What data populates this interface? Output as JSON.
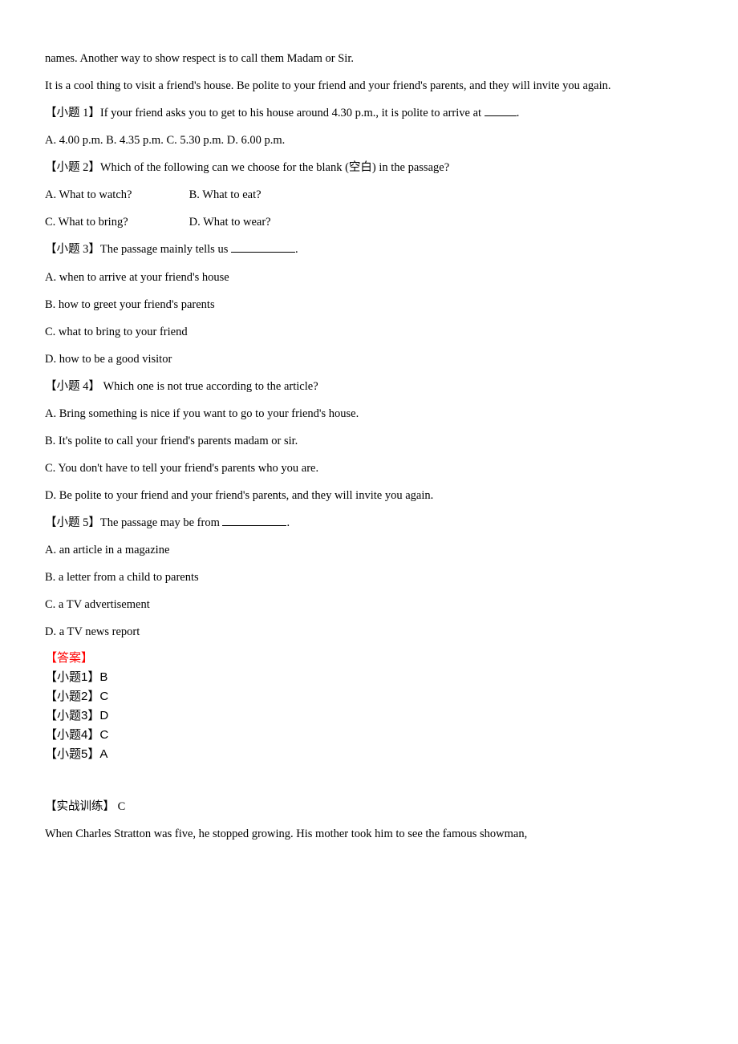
{
  "passage": {
    "line1": "names. Another way to show respect is to call them Madam or Sir.",
    "line2": "It is a cool thing to visit a friend's house. Be polite to your friend and your friend's parents, and they will invite you again."
  },
  "q1": {
    "prompt_prefix": "【小题 1】If your friend asks you to get to his house around 4.30 p.m., it is polite to arrive at ",
    "prompt_suffix": ".",
    "options": "A. 4.00 p.m. B. 4.35 p.m.    C. 5.30 p.m.    D. 6.00 p.m."
  },
  "q2": {
    "prompt": "【小题 2】Which of the following can we choose for the blank (空白) in the passage?",
    "row1_a": "A. What to watch?",
    "row1_b": "B. What to eat?",
    "row2_a": "C. What to bring?",
    "row2_b": "D. What to wear?"
  },
  "q3": {
    "prompt_prefix": "【小题 3】The passage mainly tells us ",
    "prompt_suffix": ".",
    "opt_a": "A. when to arrive at your friend's house",
    "opt_b": "B. how to greet your friend's parents",
    "opt_c": "C. what to bring to your friend",
    "opt_d": "D. how to be a good visitor"
  },
  "q4": {
    "prompt": "【小题 4】 Which one is not true according to the article?",
    "opt_a": "A. Bring something is nice if you want to go to your friend's house.",
    "opt_b": "B. It's polite to call your friend's parents madam or sir.",
    "opt_c": "C. You don't have to tell your friend's parents who you are.",
    "opt_d": "D. Be polite to your friend and your friend's parents, and they will invite you again."
  },
  "q5": {
    "prompt_prefix": "【小题 5】The passage may be from ",
    "prompt_suffix": ".",
    "opt_a": "A. an article in a magazine",
    "opt_b": "B. a letter from a child to parents",
    "opt_c": "C. a TV advertisement",
    "opt_d": "D. a TV news report"
  },
  "answers": {
    "label": "【答案】",
    "a1": "【小题1】B",
    "a2": "【小题2】C",
    "a3": "【小题3】D",
    "a4": "【小题4】C",
    "a5": "【小题5】A"
  },
  "next": {
    "heading": "【实战训练】 C",
    "para": " When Charles Stratton was five, he stopped growing. His mother took him to see the famous showman,"
  }
}
